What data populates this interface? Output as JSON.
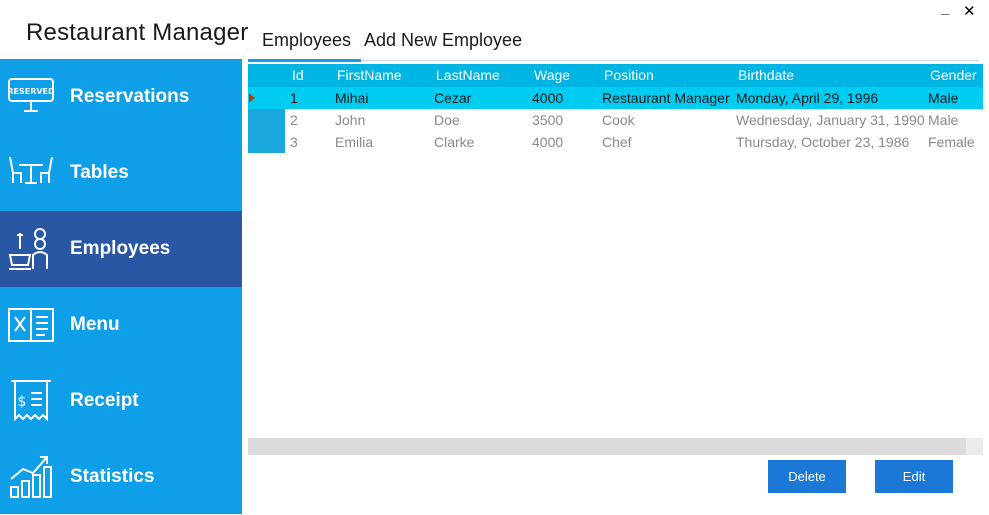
{
  "app": {
    "title": "Restaurant Manager"
  },
  "window": {
    "minimize": "_",
    "close": "✕"
  },
  "sidebar": {
    "items": [
      {
        "label": "Reservations",
        "icon": "reserved-sign-icon",
        "active": false
      },
      {
        "label": "Tables",
        "icon": "table-chairs-icon",
        "active": false
      },
      {
        "label": "Employees",
        "icon": "chef-icon",
        "active": true
      },
      {
        "label": "Menu",
        "icon": "menu-book-icon",
        "active": false
      },
      {
        "label": "Receipt",
        "icon": "receipt-icon",
        "active": false
      },
      {
        "label": "Statistics",
        "icon": "bar-chart-icon",
        "active": false
      }
    ]
  },
  "tabs": [
    {
      "label": "Employees",
      "active": true
    },
    {
      "label": "Add New Employee",
      "active": false
    }
  ],
  "grid": {
    "columns": [
      "Id",
      "FirstName",
      "LastName",
      "Wage",
      "Position",
      "Birthdate",
      "Gender"
    ],
    "rows": [
      [
        "1",
        "Mihai",
        "Cezar",
        "4000",
        "Restaurant Manager",
        "Monday, April 29, 1996",
        "Male"
      ],
      [
        "2",
        "John",
        "Doe",
        "3500",
        "Cook",
        "Wednesday, January 31, 1990",
        "Male"
      ],
      [
        "3",
        "Emilia",
        "Clarke",
        "4000",
        "Chef",
        "Thursday, October 23, 1986",
        "Female"
      ]
    ],
    "selected_row": 0
  },
  "buttons": {
    "delete": "Delete",
    "edit": "Edit"
  },
  "colors": {
    "sidebar": "#0f9ee8",
    "sidebar_active": "#2a57a3",
    "grid_header": "#00b4e4",
    "selected_row": "#00ccf2",
    "button": "#1b78d6"
  }
}
